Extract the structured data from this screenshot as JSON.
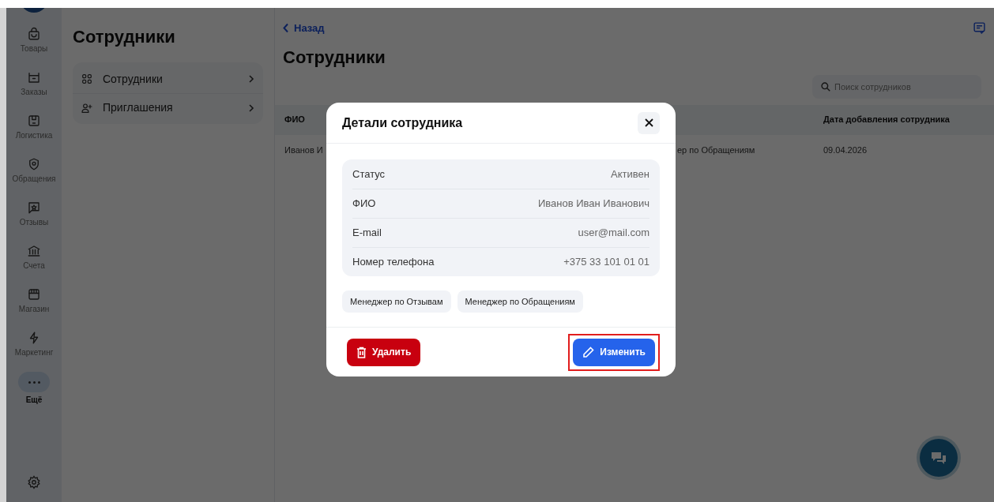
{
  "nav": {
    "items": [
      {
        "label": "Товары",
        "kind": "bag",
        "selected": false
      },
      {
        "label": "Заказы",
        "kind": "box",
        "selected": false
      },
      {
        "label": "Логистика",
        "kind": "package",
        "selected": false
      },
      {
        "label": "Обращения",
        "kind": "shield",
        "selected": false
      },
      {
        "label": "Отзывы",
        "kind": "star",
        "selected": false
      },
      {
        "label": "Счета",
        "kind": "bank",
        "selected": false
      },
      {
        "label": "Магазин",
        "kind": "store",
        "selected": false
      },
      {
        "label": "Маркетинг",
        "kind": "bolt",
        "selected": false
      },
      {
        "label": "Ещё",
        "kind": "more",
        "selected": true
      }
    ]
  },
  "section_panel": {
    "title": "Сотрудники",
    "items": [
      {
        "label": "Сотрудники",
        "kind": "grid"
      },
      {
        "label": "Приглашения",
        "kind": "person-add"
      }
    ]
  },
  "main": {
    "back_link": "Назад",
    "title": "Сотрудники",
    "search": {
      "placeholder": "Поиск сотрудников"
    },
    "table": {
      "columns": [
        "ФИО",
        "",
        "Дата добавления сотрудника"
      ],
      "rows": [
        [
          "Иванов И",
          "ер по Обращениям",
          "09.04.2026"
        ]
      ]
    }
  },
  "modal": {
    "title": "Детали сотрудника",
    "details": [
      {
        "label": "Статус",
        "value": "Активен"
      },
      {
        "label": "ФИО",
        "value": "Иванов Иван Иванович"
      },
      {
        "label": "E-mail",
        "value": "user@mail.com"
      },
      {
        "label": "Номер телефона",
        "value": "+375 33 101 01 01"
      }
    ],
    "roles": [
      "Менеджер по Отзывам",
      "Менеджер по Обращениям"
    ],
    "buttons": [
      {
        "label": "Удалить",
        "kind": "delete",
        "highlighted": false
      },
      {
        "label": "Изменить",
        "kind": "edit",
        "highlighted": true
      }
    ]
  }
}
